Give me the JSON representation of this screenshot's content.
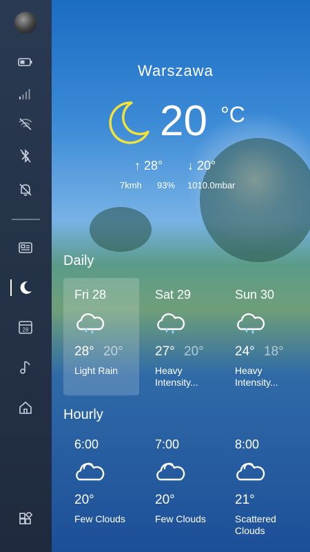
{
  "location": {
    "city": "Warszawa"
  },
  "current": {
    "temp": "20",
    "unit": "°C",
    "high": "↑ 28°",
    "low": "↓ 20°",
    "wind": "7kmh",
    "humidity": "93%",
    "pressure": "1010.0mbar"
  },
  "daily": {
    "title": "Daily",
    "days": [
      {
        "name": "Fri 28",
        "high": "28°",
        "low": "20°",
        "desc": "Light Rain"
      },
      {
        "name": "Sat 29",
        "high": "27°",
        "low": "20°",
        "desc": "Heavy Intensity..."
      },
      {
        "name": "Sun 30",
        "high": "24°",
        "low": "18°",
        "desc": "Heavy Intensity..."
      }
    ]
  },
  "hourly": {
    "title": "Hourly",
    "hours": [
      {
        "time": "6:00",
        "temp": "20°",
        "desc": "Few Clouds"
      },
      {
        "time": "7:00",
        "temp": "20°",
        "desc": "Few Clouds"
      },
      {
        "time": "8:00",
        "temp": "21°",
        "desc": "Scattered Clouds"
      }
    ]
  },
  "sidebar": {
    "icons": [
      "battery-icon",
      "signal-icon",
      "wifi-off-icon",
      "bluetooth-off-icon",
      "notifications-off-icon",
      "news-icon",
      "weather-moon-icon",
      "calendar-icon",
      "music-icon",
      "home-icon",
      "widgets-icon"
    ],
    "calendar_day": "28"
  },
  "colors": {
    "moon": "#f2e23a",
    "sidebar": "#24324a",
    "accent": "#1d5aa8"
  }
}
